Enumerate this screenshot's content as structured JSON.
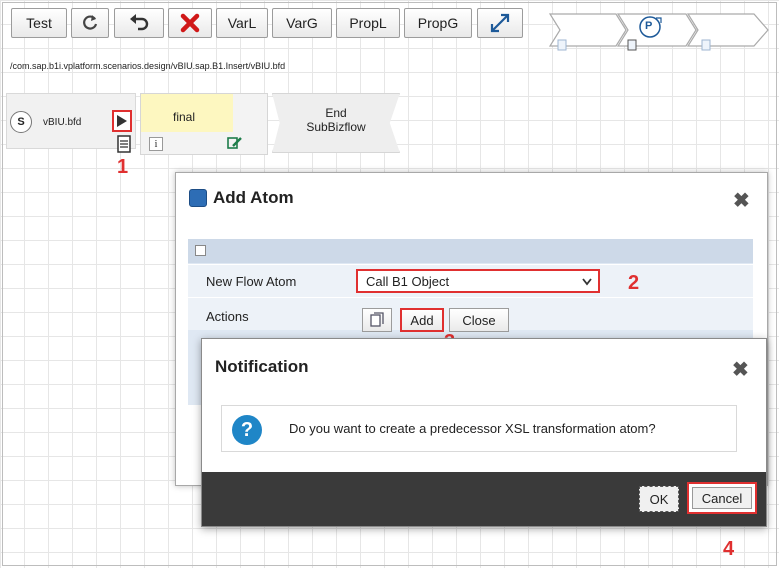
{
  "toolbar": {
    "test_label": "Test",
    "varl_label": "VarL",
    "varg_label": "VarG",
    "propl_label": "PropL",
    "propg_label": "PropG"
  },
  "breadcrumb": {
    "path": "/com.sap.b1i.vplatform.scenarios.design/vBIU.sap.B1.Insert/vBIU.bfd"
  },
  "mini_flow": {
    "process_label": "P"
  },
  "flow": {
    "start_badge": "S",
    "start_file": "vBIU.bfd",
    "final_label": "final",
    "info_glyph": "i",
    "end_label_line1": "End",
    "end_label_line2": "SubBizflow"
  },
  "callouts": [
    "1",
    "2",
    "3",
    "4"
  ],
  "add_atom_dialog": {
    "title": "Add Atom",
    "close_glyph": "✖",
    "new_flow_atom_label": "New Flow Atom",
    "new_flow_atom_value": "Call B1 Object",
    "actions_label": "Actions",
    "add_label": "Add",
    "close_label": "Close"
  },
  "notification_dialog": {
    "title": "Notification",
    "close_glyph": "✖",
    "question_glyph": "?",
    "message": "Do you want to create a predecessor XSL transformation atom?",
    "ok_label": "OK",
    "cancel_label": "Cancel"
  },
  "colors": {
    "highlight": "#e03030",
    "form_background": "#dfe8f3",
    "footer_background": "#3a3a3a",
    "question_icon": "#1f86c7"
  },
  "icons": [
    "refresh-icon",
    "undo-icon",
    "delete-x-icon",
    "expand-icon",
    "play-icon",
    "document-icon",
    "edit-icon",
    "copy-icon",
    "question-icon",
    "dialog-app-icon",
    "chevron-down-icon"
  ]
}
